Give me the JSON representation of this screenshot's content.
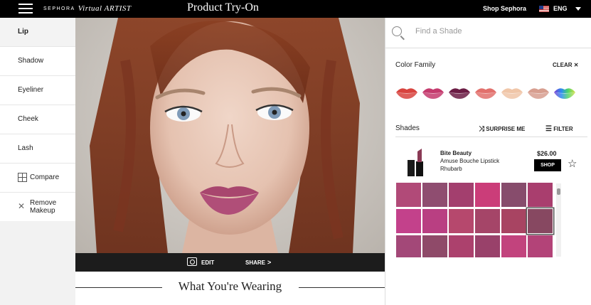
{
  "topbar": {
    "brand_prefix": "SEPHORA",
    "brand_name": "Virtual ARTIST",
    "title": "Product Try-On",
    "shop_link": "Shop Sephora",
    "language": "ENG"
  },
  "sidebar": {
    "items": [
      {
        "label": "Lip"
      },
      {
        "label": "Shadow"
      },
      {
        "label": "Eyeliner"
      },
      {
        "label": "Cheek"
      },
      {
        "label": "Lash"
      },
      {
        "label": "Compare"
      },
      {
        "label": "Remove Makeup"
      }
    ]
  },
  "photo": {
    "edit_label": "EDIT",
    "share_label": "SHARE"
  },
  "wearing_title": "What You're Wearing",
  "right_panel": {
    "search_placeholder": "Find a Shade",
    "color_family_title": "Color Family",
    "clear_label": "CLEAR",
    "color_families": [
      "#d8433e",
      "#c43a6d",
      "#6b1c44",
      "#e2706c",
      "#f0c6a8",
      "#d79e8f",
      "multicolor"
    ],
    "shades_title": "Shades",
    "surprise_label": "SURPRISE ME",
    "filter_label": "FILTER",
    "product": {
      "brand": "Bite Beauty",
      "name": "Amuse Bouche Lipstick",
      "shade": "Rhubarb",
      "price": "$26.00",
      "shop_label": "SHOP"
    },
    "shade_grid": [
      "#b14a78",
      "#8f4d70",
      "#a33f6e",
      "#cb3d79",
      "#874c6c",
      "#a93e6e",
      "#c3418b",
      "#b93f82",
      "#b6486d",
      "#a54568",
      "#a84462",
      "#874861",
      "#a34878",
      "#8f4a69",
      "#ac416d",
      "#99416a",
      "#c2437d",
      "#b34378"
    ],
    "selected_shade_index": 11
  }
}
